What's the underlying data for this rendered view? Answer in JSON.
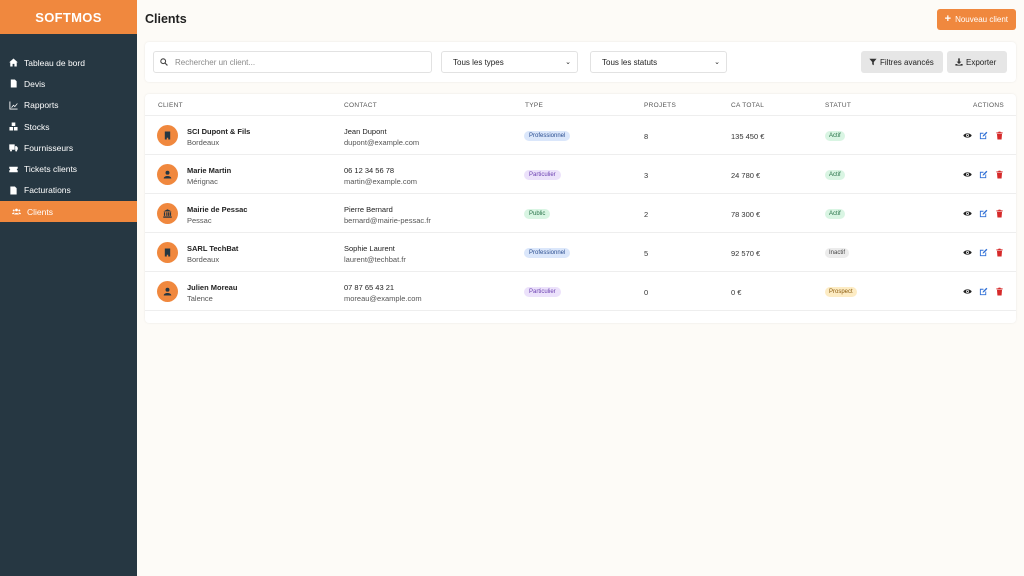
{
  "brand": "SOFTMOS",
  "sidebar": {
    "items": [
      {
        "label": "Tableau de bord",
        "icon": "home-icon"
      },
      {
        "label": "Devis",
        "icon": "file-icon"
      },
      {
        "label": "Rapports",
        "icon": "chart-line-icon"
      },
      {
        "label": "Stocks",
        "icon": "boxes-icon"
      },
      {
        "label": "Fournisseurs",
        "icon": "truck-icon"
      },
      {
        "label": "Tickets clients",
        "icon": "ticket-icon"
      },
      {
        "label": "Facturations",
        "icon": "invoice-icon"
      },
      {
        "label": "Clients",
        "icon": "users-icon",
        "active": true
      }
    ]
  },
  "header": {
    "title": "Clients",
    "new_button": "Nouveau client"
  },
  "filters": {
    "search_placeholder": "Rechercher un client...",
    "type_select": "Tous les types",
    "status_select": "Tous les statuts",
    "advanced_button": "Filtres avancés",
    "export_button": "Exporter"
  },
  "table": {
    "columns": [
      "CLIENT",
      "CONTACT",
      "TYPE",
      "PROJETS",
      "CA TOTAL",
      "STATUT",
      "ACTIONS"
    ],
    "rows": [
      {
        "name": "SCI Dupont & Fils",
        "city": "Bordeaux",
        "contact": "Jean Dupont",
        "email": "dupont@example.com",
        "type": "Professionnel",
        "projects": "8",
        "ca": "135 450 €",
        "status": "Actif",
        "avatar": "building-icon"
      },
      {
        "name": "Marie Martin",
        "city": "Mérignac",
        "contact": "06 12 34 56 78",
        "email": "martin@example.com",
        "type": "Particulier",
        "projects": "3",
        "ca": "24 780 €",
        "status": "Actif",
        "avatar": "user-icon"
      },
      {
        "name": "Mairie de Pessac",
        "city": "Pessac",
        "contact": "Pierre Bernard",
        "email": "bernard@mairie-pessac.fr",
        "type": "Public",
        "projects": "2",
        "ca": "78 300 €",
        "status": "Actif",
        "avatar": "landmark-icon"
      },
      {
        "name": "SARL TechBat",
        "city": "Bordeaux",
        "contact": "Sophie Laurent",
        "email": "laurent@techbat.fr",
        "type": "Professionnel",
        "projects": "5",
        "ca": "92 570 €",
        "status": "Inactif",
        "avatar": "building-icon"
      },
      {
        "name": "Julien Moreau",
        "city": "Talence",
        "contact": "07 87 65 43 21",
        "email": "moreau@example.com",
        "type": "Particulier",
        "projects": "0",
        "ca": "0 €",
        "status": "Prospect",
        "avatar": "user-icon"
      }
    ]
  },
  "colors": {
    "accent": "#f0883e",
    "sidebar": "#263742",
    "type_professionnel": {
      "bg": "#dbe7fb",
      "fg": "#2a4d8f"
    },
    "type_particulier": {
      "bg": "#ece2fb",
      "fg": "#6a3fb0"
    },
    "type_public": {
      "bg": "#d9f5e3",
      "fg": "#257046"
    },
    "status_actif": {
      "bg": "#d9f5e3",
      "fg": "#257046"
    },
    "status_inactif": {
      "bg": "#ececec",
      "fg": "#444444"
    },
    "status_prospect": {
      "bg": "#fdecc4",
      "fg": "#8a5a0c"
    }
  }
}
